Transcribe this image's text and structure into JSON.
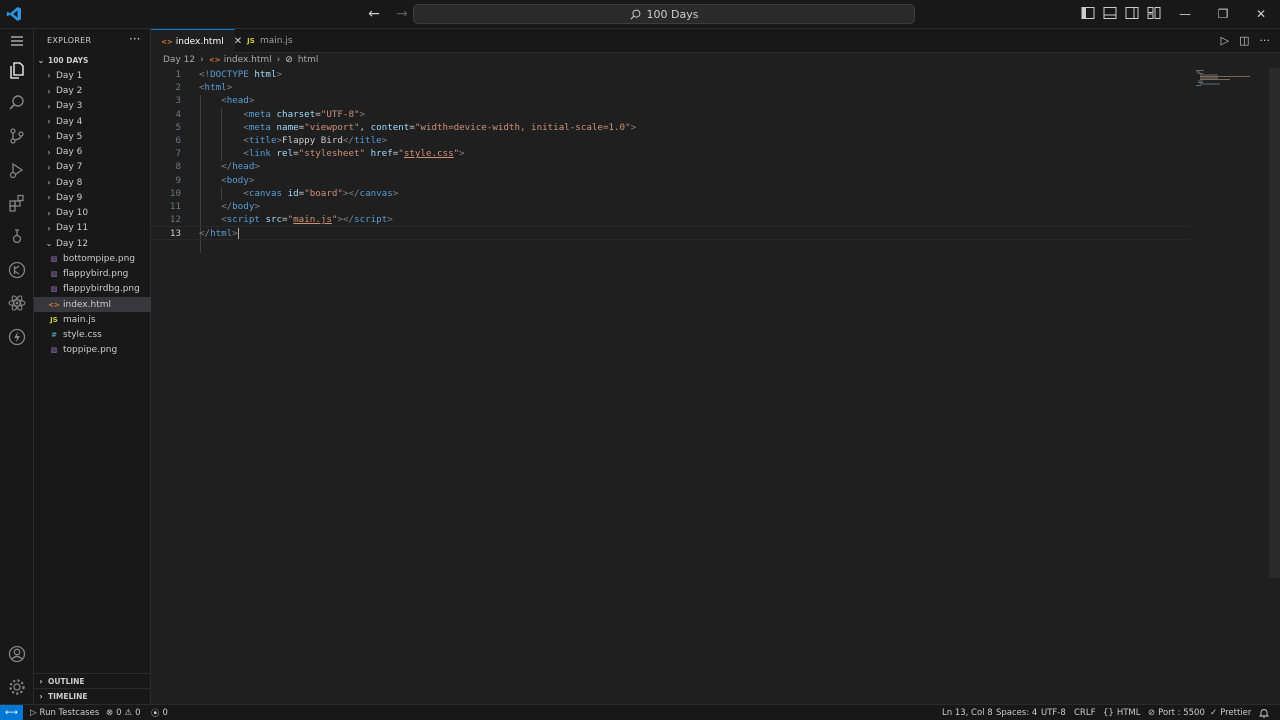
{
  "titlebar": {
    "search_text": "100 Days",
    "window_controls": [
      "—",
      "❐",
      "✕"
    ]
  },
  "activitybar": {
    "icons": [
      "explorer-icon",
      "search-icon",
      "source-control-icon",
      "run-debug-icon",
      "extensions-icon",
      "testing-icon",
      "git-graph-icon",
      "react-icon",
      "thunder-client-icon",
      "accounts-icon",
      "manage-icon"
    ]
  },
  "sidebar": {
    "title": "EXPLORER",
    "more": "···",
    "root": "100 DAYS",
    "folders": [
      {
        "label": "Day 1"
      },
      {
        "label": "Day 2"
      },
      {
        "label": "Day 3"
      },
      {
        "label": "Day 4"
      },
      {
        "label": "Day 5"
      },
      {
        "label": "Day 6"
      },
      {
        "label": "Day 7"
      },
      {
        "label": "Day 8"
      },
      {
        "label": "Day 9"
      },
      {
        "label": "Day 10"
      },
      {
        "label": "Day 11"
      }
    ],
    "open_folder": "Day 12",
    "files": [
      {
        "label": "bottompipe.png",
        "icon": "png",
        "glyph": "▨"
      },
      {
        "label": "flappybird.png",
        "icon": "png",
        "glyph": "▨"
      },
      {
        "label": "flappybirdbg.png",
        "icon": "png",
        "glyph": "▨"
      },
      {
        "label": "index.html",
        "icon": "html",
        "glyph": "<>"
      },
      {
        "label": "main.js",
        "icon": "js",
        "glyph": "JS"
      },
      {
        "label": "style.css",
        "icon": "css",
        "glyph": "#"
      },
      {
        "label": "toppipe.png",
        "icon": "png",
        "glyph": "▨"
      }
    ],
    "selected_file": "index.html",
    "outline": "OUTLINE",
    "timeline": "TIMELINE"
  },
  "tabs": [
    {
      "label": "index.html",
      "icon": "<>",
      "active": true,
      "close": "✕"
    },
    {
      "label": "main.js",
      "icon": "JS",
      "active": false
    }
  ],
  "breadcrumb": {
    "folder": "Day 12",
    "sep": "›",
    "file": "index.html",
    "symbol": "html"
  },
  "editor": {
    "current_line": 13,
    "line_numbers": [
      "1",
      "2",
      "3",
      "4",
      "5",
      "6",
      "7",
      "8",
      "9",
      "10",
      "11",
      "12",
      "13"
    ]
  },
  "statusbar": {
    "remote": "⟷",
    "run_testcases": "Run Testcases",
    "errors": "0",
    "warnings": "0",
    "ports": "0",
    "cursor_pos": "Ln 13, Col 8",
    "indent": "Spaces: 4",
    "encoding": "UTF-8",
    "eol": "CRLF",
    "language": "HTML",
    "port": "Port : 5500",
    "prettier": "Prettier"
  },
  "colors": {
    "accent": "#0078d4",
    "bg": "#1f1f1f",
    "sidebar_bg": "#181818"
  }
}
